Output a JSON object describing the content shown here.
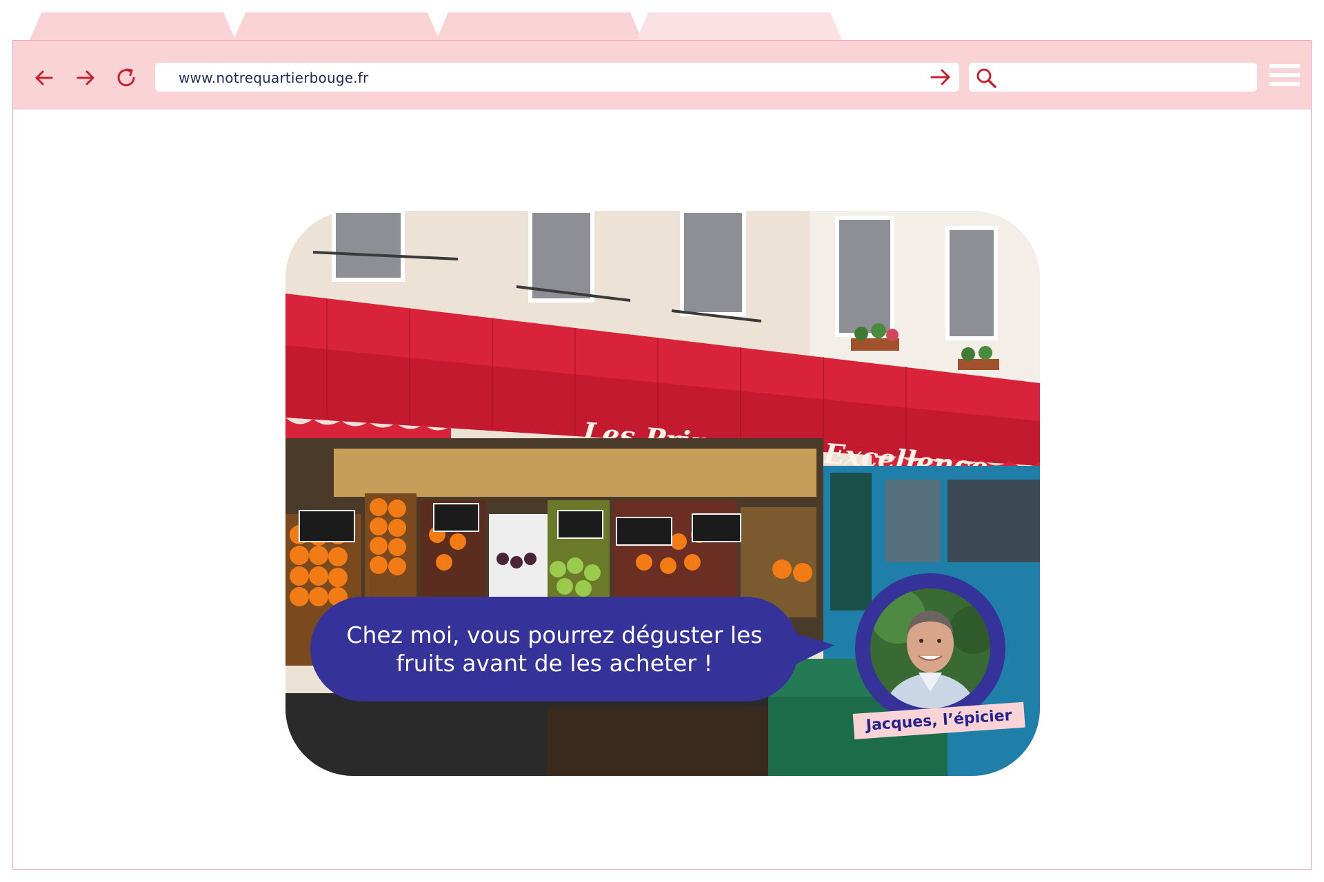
{
  "browser": {
    "url": "www.notrequartierbouge.fr",
    "search_placeholder": "",
    "accent_color": "#c8202f",
    "chrome_color": "#f9d3d6",
    "icons": [
      "back-arrow-icon",
      "forward-arrow-icon",
      "reload-icon",
      "go-arrow-icon",
      "search-icon",
      "menu-icon"
    ]
  },
  "content": {
    "photo_subject": "Les Primeurs d'Excellence",
    "shop_sign": "Les Primeurs d'Excellence",
    "quote": "Chez moi, vous pourrez déguster les fruits avant de les acheter !",
    "person_label": "Jacques, l’épicier",
    "bubble_color": "#35339a"
  }
}
